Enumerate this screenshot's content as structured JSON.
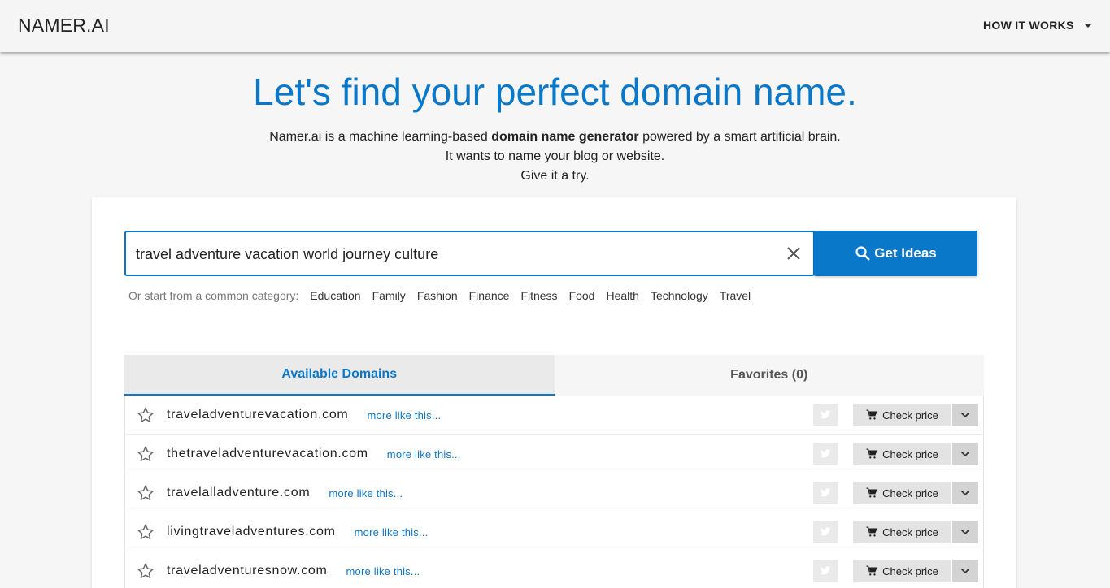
{
  "header": {
    "logo": "NAMER.AI",
    "nav_how_it_works": "HOW IT WORKS"
  },
  "hero": {
    "title": "Let's find your perfect domain name.",
    "line1_pre": "Namer.ai is a machine learning-based ",
    "line1_bold": "domain name generator",
    "line1_post": " powered by a smart artificial brain.",
    "line2": "It wants to name your blog or website.",
    "line3": "Give it a try."
  },
  "search": {
    "value": "travel adventure vacation world journey culture",
    "button_label": "Get Ideas"
  },
  "categories": {
    "label": "Or start from a common category:",
    "items": [
      "Education",
      "Family",
      "Fashion",
      "Finance",
      "Fitness",
      "Food",
      "Health",
      "Technology",
      "Travel"
    ]
  },
  "tabs": {
    "available": "Available Domains",
    "favorites": "Favorites (0)"
  },
  "results": [
    {
      "domain": "traveladventurevacation.com",
      "more": "more like this...",
      "price": "Check price"
    },
    {
      "domain": "thetraveladventurevacation.com",
      "more": "more like this...",
      "price": "Check price"
    },
    {
      "domain": "travelalladventure.com",
      "more": "more like this...",
      "price": "Check price"
    },
    {
      "domain": "livingtraveladventures.com",
      "more": "more like this...",
      "price": "Check price"
    },
    {
      "domain": "traveladventuresnow.com",
      "more": "more like this...",
      "price": "Check price"
    }
  ],
  "icons": {
    "star": "star-outline-icon",
    "twitter": "twitter-icon",
    "cart": "cart-icon",
    "chevron": "chevron-down-icon",
    "search": "search-icon",
    "clear": "close-icon"
  },
  "colors": {
    "accent": "#0a78c8",
    "background": "#f6f6f6"
  }
}
